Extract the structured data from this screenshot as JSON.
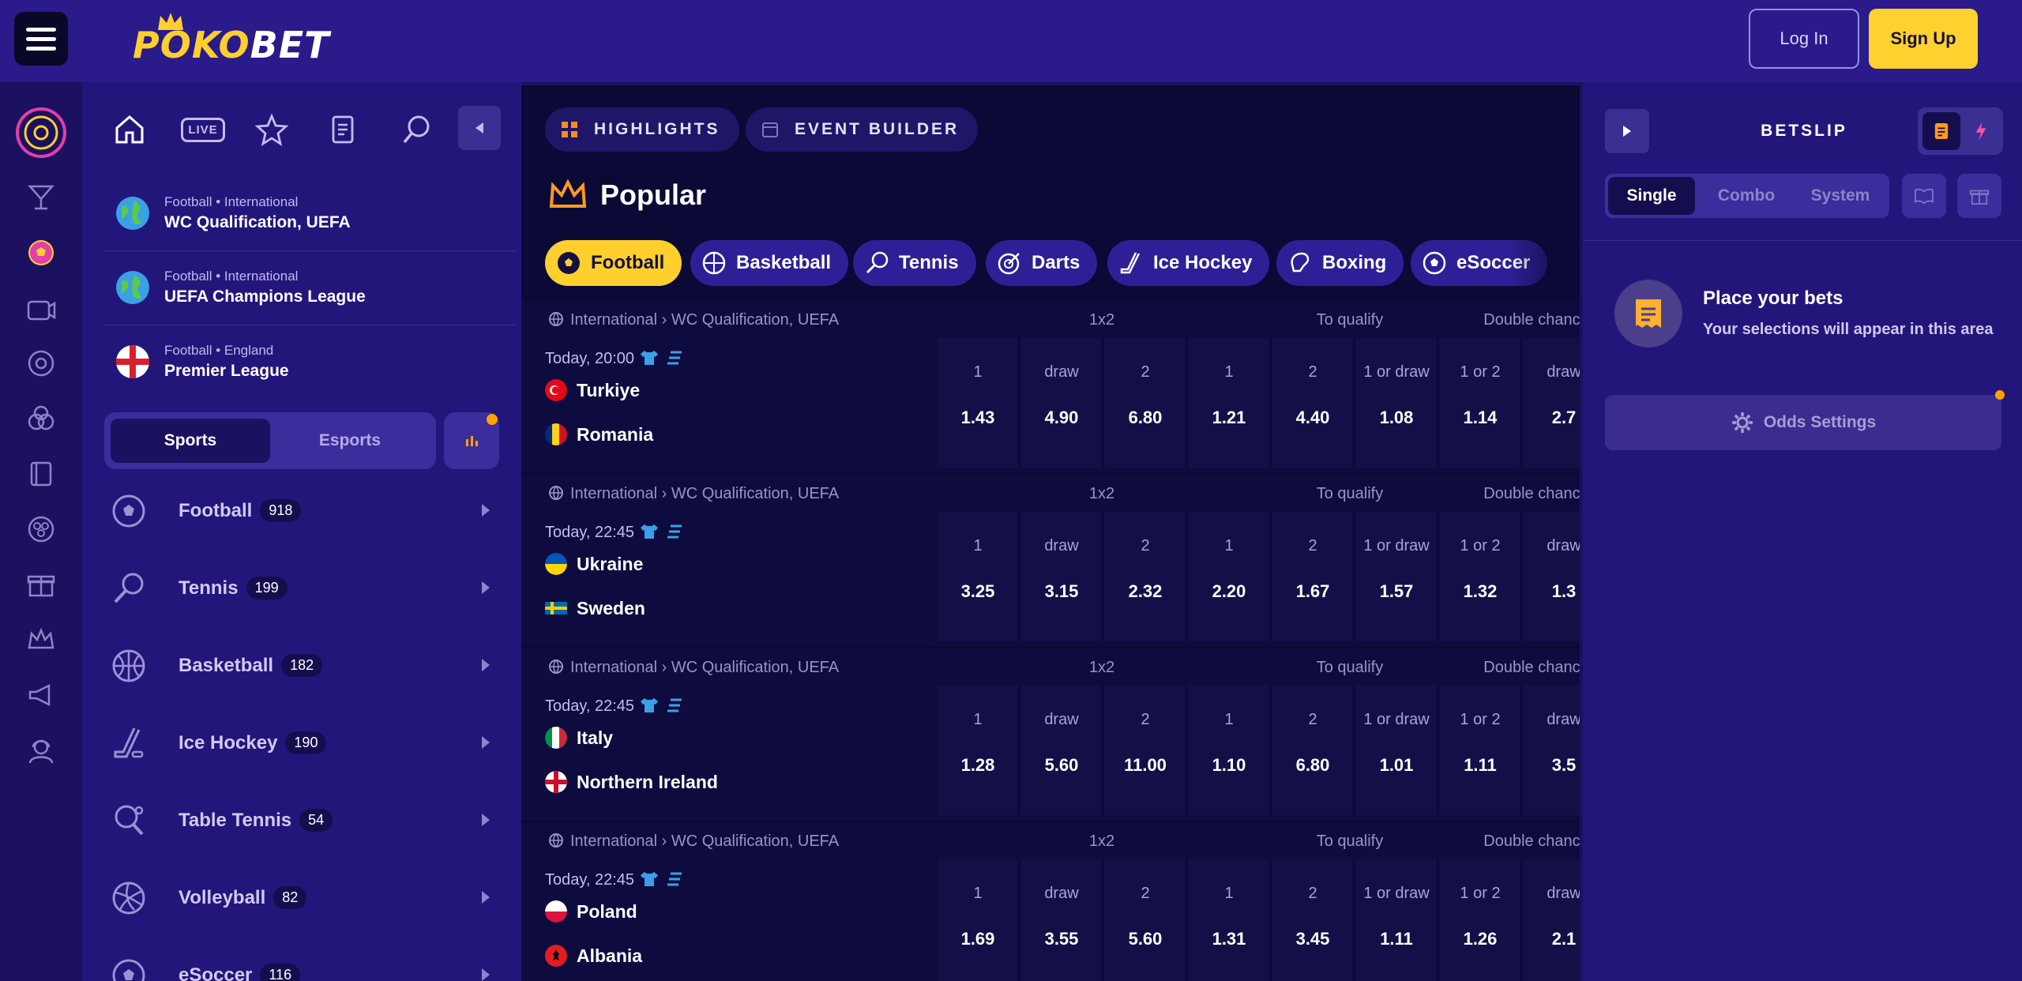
{
  "header": {
    "logo_part1": "POKO",
    "logo_part2": "BET",
    "login_label": "Log In",
    "signup_label": "Sign Up"
  },
  "leftnav": {
    "live_label": "LIVE",
    "leagues": [
      {
        "meta": "Football • International",
        "name": "WC Qualification, UEFA"
      },
      {
        "meta": "Football • International",
        "name": "UEFA Champions League"
      },
      {
        "meta": "Football • England",
        "name": "Premier League"
      }
    ],
    "segment": {
      "sports": "Sports",
      "esports": "Esports"
    },
    "sports": [
      {
        "name": "Football",
        "count": "918"
      },
      {
        "name": "Tennis",
        "count": "199"
      },
      {
        "name": "Basketball",
        "count": "182"
      },
      {
        "name": "Ice Hockey",
        "count": "190"
      },
      {
        "name": "Table Tennis",
        "count": "54"
      },
      {
        "name": "Volleyball",
        "count": "82"
      },
      {
        "name": "eSoccer",
        "count": "116"
      }
    ]
  },
  "main": {
    "tabs": [
      "HIGHLIGHTS",
      "EVENT BUILDER"
    ],
    "popular_title": "Popular",
    "chips": [
      "Football",
      "Basketball",
      "Tennis",
      "Darts",
      "Ice Hockey",
      "Boxing",
      "eSoccer"
    ],
    "groups": [
      "1x2",
      "To qualify",
      "Double chance"
    ],
    "labels": [
      "1",
      "draw",
      "2",
      "1",
      "2",
      "1 or draw",
      "1 or 2",
      "draw"
    ],
    "events": [
      {
        "competition": "International › WC Qualification, UEFA",
        "time": "Today, 20:00",
        "home": "Turkiye",
        "away": "Romania",
        "odds": [
          "1.43",
          "4.90",
          "6.80",
          "1.21",
          "4.40",
          "1.08",
          "1.14",
          "2.7"
        ]
      },
      {
        "competition": "International › WC Qualification, UEFA",
        "time": "Today, 22:45",
        "home": "Ukraine",
        "away": "Sweden",
        "odds": [
          "3.25",
          "3.15",
          "2.32",
          "2.20",
          "1.67",
          "1.57",
          "1.32",
          "1.3"
        ]
      },
      {
        "competition": "International › WC Qualification, UEFA",
        "time": "Today, 22:45",
        "home": "Italy",
        "away": "Northern Ireland",
        "odds": [
          "1.28",
          "5.60",
          "11.00",
          "1.10",
          "6.80",
          "1.01",
          "1.11",
          "3.5"
        ]
      },
      {
        "competition": "International › WC Qualification, UEFA",
        "time": "Today, 22:45",
        "home": "Poland",
        "away": "Albania",
        "odds": [
          "1.69",
          "3.55",
          "5.60",
          "1.31",
          "3.45",
          "1.11",
          "1.26",
          "2.1"
        ]
      }
    ]
  },
  "betslip": {
    "title": "BETSLIP",
    "modes": [
      "Single",
      "Combo",
      "System"
    ],
    "empty_title": "Place your bets",
    "empty_sub": "Your selections will appear in this area",
    "odds_settings": "Odds Settings"
  },
  "colors": {
    "header_bg": "#2a1a8a",
    "nav_bg": "#23167a",
    "main_bg": "#0b0935",
    "accent": "#ffcf2e",
    "notice_dot": "#ffa200"
  }
}
